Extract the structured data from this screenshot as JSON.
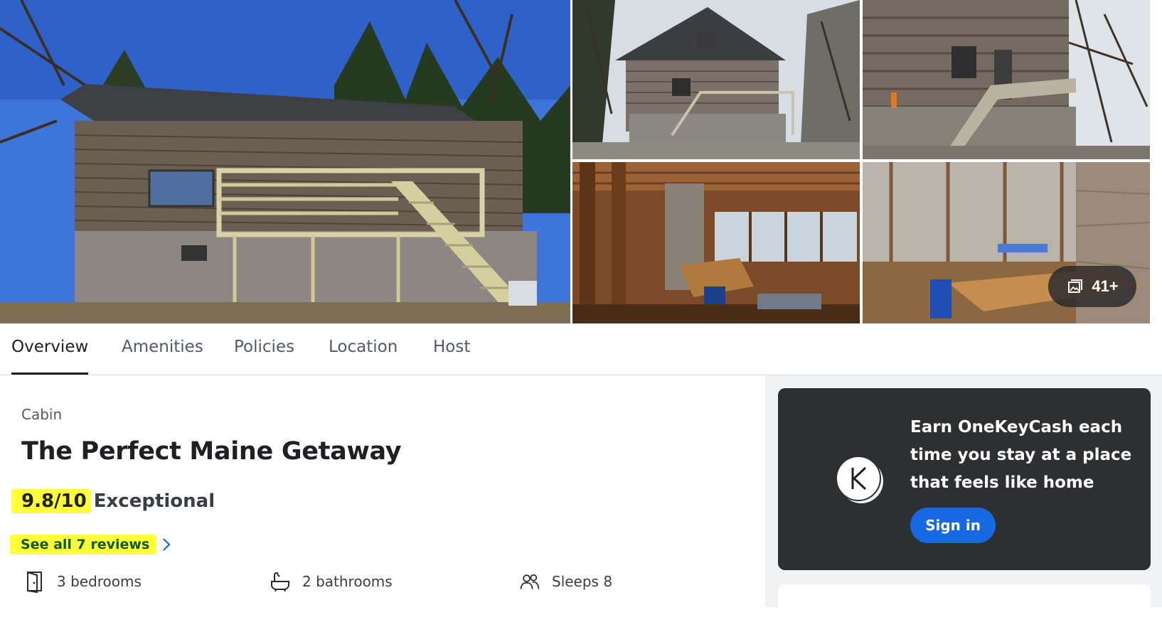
{
  "gallery": {
    "more_photos_label": "41+",
    "photos": [
      {
        "name": "exterior-main",
        "alt": "log cabin exterior with deck"
      },
      {
        "name": "exterior-front",
        "alt": "cabin front with stairs"
      },
      {
        "name": "exterior-side",
        "alt": "cabin side with porch"
      },
      {
        "name": "interior-dining",
        "alt": "dining room interior"
      },
      {
        "name": "porch-table",
        "alt": "screened porch with table"
      }
    ]
  },
  "tabs": [
    {
      "label": "Overview",
      "active": true
    },
    {
      "label": "Amenities",
      "active": false
    },
    {
      "label": "Policies",
      "active": false
    },
    {
      "label": "Location",
      "active": false
    },
    {
      "label": "Host",
      "active": false
    }
  ],
  "property": {
    "type": "Cabin",
    "title": "The Perfect Maine Getaway",
    "rating_score": "9.8/10",
    "rating_label": "Exceptional",
    "reviews_link": "See all 7 reviews",
    "facts": {
      "bedrooms": "3 bedrooms",
      "bathrooms": "2 bathrooms",
      "sleeps": "Sleeps 8"
    }
  },
  "promo": {
    "logo_letter": "K",
    "text": "Earn OneKeyCash each time you stay at a place that feels like home",
    "button_label": "Sign in"
  },
  "colors": {
    "highlight": "#ffff3a",
    "link_green": "#0b5a2a",
    "promo_bg": "#2e2f31",
    "primary_button": "#1668e3"
  }
}
